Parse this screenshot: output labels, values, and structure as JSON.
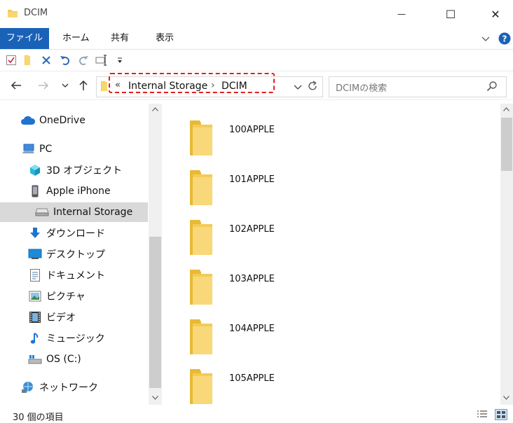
{
  "window": {
    "title": "DCIM",
    "controls": {
      "minimize": "—",
      "maximize": "☐",
      "close": "✕"
    }
  },
  "ribbon": {
    "tabs": [
      {
        "label": "ファイル",
        "active": true
      },
      {
        "label": "ホーム"
      },
      {
        "label": "共有"
      },
      {
        "label": "表示"
      }
    ]
  },
  "address": {
    "prefix": "«",
    "segments": [
      "Internal Storage",
      "DCIM"
    ],
    "separator": "›"
  },
  "search": {
    "placeholder": "DCIMの検索"
  },
  "nav": {
    "items": [
      {
        "label": "OneDrive",
        "icon": "cloud-icon"
      },
      {
        "label": "PC",
        "icon": "computer-icon"
      },
      {
        "label": "3D オブジェクト",
        "icon": "cube-icon"
      },
      {
        "label": "Apple iPhone",
        "icon": "phone-icon"
      },
      {
        "label": "Internal Storage",
        "icon": "drive-icon",
        "selected": true
      },
      {
        "label": "ダウンロード",
        "icon": "download-icon"
      },
      {
        "label": "デスクトップ",
        "icon": "desktop-icon"
      },
      {
        "label": "ドキュメント",
        "icon": "document-icon"
      },
      {
        "label": "ピクチャ",
        "icon": "pictures-icon"
      },
      {
        "label": "ビデオ",
        "icon": "video-icon"
      },
      {
        "label": "ミュージック",
        "icon": "music-icon"
      },
      {
        "label": "OS (C:)",
        "icon": "os-drive-icon"
      },
      {
        "label": "ネットワーク",
        "icon": "network-icon"
      }
    ]
  },
  "folders": [
    "100APPLE",
    "101APPLE",
    "102APPLE",
    "103APPLE",
    "104APPLE",
    "105APPLE"
  ],
  "status": {
    "item_count": "30 個の項目"
  },
  "colors": {
    "accent": "#1a62b8",
    "folder": "#f6d36b",
    "highlight": "#e02020"
  }
}
